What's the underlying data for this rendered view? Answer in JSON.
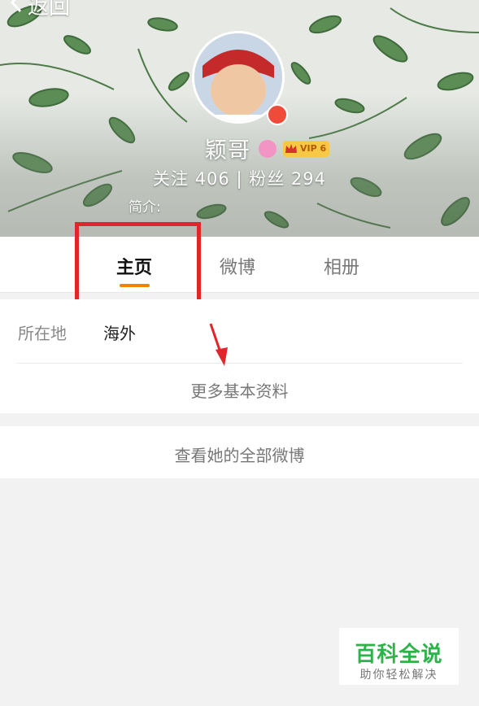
{
  "header": {
    "back_label": "返回",
    "username": "颖哥",
    "vip_label": "VIP 6",
    "stats_text": "关注  406  |  粉丝  294",
    "intro_label": "简介:"
  },
  "tabs": [
    {
      "label": "主页",
      "active": true
    },
    {
      "label": "微博",
      "active": false
    },
    {
      "label": "相册",
      "active": false
    }
  ],
  "profile": {
    "location_label": "所在地",
    "location_value": "海外",
    "more_info": "更多基本资料"
  },
  "all_weibo": "查看她的全部微博",
  "watermark": {
    "title": "百科全说",
    "subtitle": "助你轻松解决"
  },
  "colors": {
    "accent": "#f08300",
    "highlight": "#e0262b",
    "watermark": "#2cb34a"
  }
}
